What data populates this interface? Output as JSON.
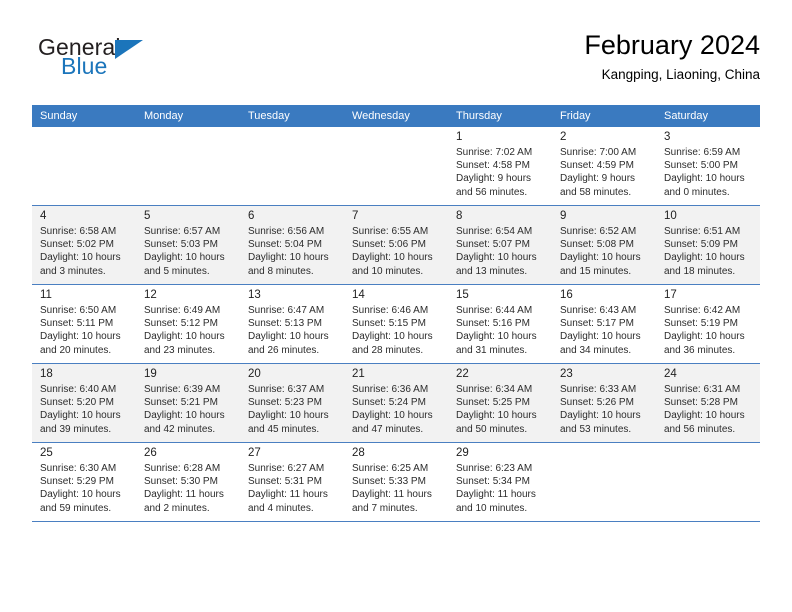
{
  "brand": {
    "name_part1": "General",
    "name_part2": "Blue",
    "triangle_color": "#1b75bb"
  },
  "header": {
    "title": "February 2024",
    "subtitle": "Kangping, Liaoning, China"
  },
  "theme": {
    "header_row_bg": "#3a7ac0",
    "header_row_text": "#ffffff",
    "row_shade_bg": "#f2f2f2",
    "row_border": "#4a7fc1"
  },
  "weekdays": [
    "Sunday",
    "Monday",
    "Tuesday",
    "Wednesday",
    "Thursday",
    "Friday",
    "Saturday"
  ],
  "weeks": [
    [
      {
        "day": "",
        "sunrise": "",
        "sunset": "",
        "daylight1": "",
        "daylight2": ""
      },
      {
        "day": "",
        "sunrise": "",
        "sunset": "",
        "daylight1": "",
        "daylight2": ""
      },
      {
        "day": "",
        "sunrise": "",
        "sunset": "",
        "daylight1": "",
        "daylight2": ""
      },
      {
        "day": "",
        "sunrise": "",
        "sunset": "",
        "daylight1": "",
        "daylight2": ""
      },
      {
        "day": "1",
        "sunrise": "Sunrise: 7:02 AM",
        "sunset": "Sunset: 4:58 PM",
        "daylight1": "Daylight: 9 hours",
        "daylight2": "and 56 minutes."
      },
      {
        "day": "2",
        "sunrise": "Sunrise: 7:00 AM",
        "sunset": "Sunset: 4:59 PM",
        "daylight1": "Daylight: 9 hours",
        "daylight2": "and 58 minutes."
      },
      {
        "day": "3",
        "sunrise": "Sunrise: 6:59 AM",
        "sunset": "Sunset: 5:00 PM",
        "daylight1": "Daylight: 10 hours",
        "daylight2": "and 0 minutes."
      }
    ],
    [
      {
        "day": "4",
        "sunrise": "Sunrise: 6:58 AM",
        "sunset": "Sunset: 5:02 PM",
        "daylight1": "Daylight: 10 hours",
        "daylight2": "and 3 minutes."
      },
      {
        "day": "5",
        "sunrise": "Sunrise: 6:57 AM",
        "sunset": "Sunset: 5:03 PM",
        "daylight1": "Daylight: 10 hours",
        "daylight2": "and 5 minutes."
      },
      {
        "day": "6",
        "sunrise": "Sunrise: 6:56 AM",
        "sunset": "Sunset: 5:04 PM",
        "daylight1": "Daylight: 10 hours",
        "daylight2": "and 8 minutes."
      },
      {
        "day": "7",
        "sunrise": "Sunrise: 6:55 AM",
        "sunset": "Sunset: 5:06 PM",
        "daylight1": "Daylight: 10 hours",
        "daylight2": "and 10 minutes."
      },
      {
        "day": "8",
        "sunrise": "Sunrise: 6:54 AM",
        "sunset": "Sunset: 5:07 PM",
        "daylight1": "Daylight: 10 hours",
        "daylight2": "and 13 minutes."
      },
      {
        "day": "9",
        "sunrise": "Sunrise: 6:52 AM",
        "sunset": "Sunset: 5:08 PM",
        "daylight1": "Daylight: 10 hours",
        "daylight2": "and 15 minutes."
      },
      {
        "day": "10",
        "sunrise": "Sunrise: 6:51 AM",
        "sunset": "Sunset: 5:09 PM",
        "daylight1": "Daylight: 10 hours",
        "daylight2": "and 18 minutes."
      }
    ],
    [
      {
        "day": "11",
        "sunrise": "Sunrise: 6:50 AM",
        "sunset": "Sunset: 5:11 PM",
        "daylight1": "Daylight: 10 hours",
        "daylight2": "and 20 minutes."
      },
      {
        "day": "12",
        "sunrise": "Sunrise: 6:49 AM",
        "sunset": "Sunset: 5:12 PM",
        "daylight1": "Daylight: 10 hours",
        "daylight2": "and 23 minutes."
      },
      {
        "day": "13",
        "sunrise": "Sunrise: 6:47 AM",
        "sunset": "Sunset: 5:13 PM",
        "daylight1": "Daylight: 10 hours",
        "daylight2": "and 26 minutes."
      },
      {
        "day": "14",
        "sunrise": "Sunrise: 6:46 AM",
        "sunset": "Sunset: 5:15 PM",
        "daylight1": "Daylight: 10 hours",
        "daylight2": "and 28 minutes."
      },
      {
        "day": "15",
        "sunrise": "Sunrise: 6:44 AM",
        "sunset": "Sunset: 5:16 PM",
        "daylight1": "Daylight: 10 hours",
        "daylight2": "and 31 minutes."
      },
      {
        "day": "16",
        "sunrise": "Sunrise: 6:43 AM",
        "sunset": "Sunset: 5:17 PM",
        "daylight1": "Daylight: 10 hours",
        "daylight2": "and 34 minutes."
      },
      {
        "day": "17",
        "sunrise": "Sunrise: 6:42 AM",
        "sunset": "Sunset: 5:19 PM",
        "daylight1": "Daylight: 10 hours",
        "daylight2": "and 36 minutes."
      }
    ],
    [
      {
        "day": "18",
        "sunrise": "Sunrise: 6:40 AM",
        "sunset": "Sunset: 5:20 PM",
        "daylight1": "Daylight: 10 hours",
        "daylight2": "and 39 minutes."
      },
      {
        "day": "19",
        "sunrise": "Sunrise: 6:39 AM",
        "sunset": "Sunset: 5:21 PM",
        "daylight1": "Daylight: 10 hours",
        "daylight2": "and 42 minutes."
      },
      {
        "day": "20",
        "sunrise": "Sunrise: 6:37 AM",
        "sunset": "Sunset: 5:23 PM",
        "daylight1": "Daylight: 10 hours",
        "daylight2": "and 45 minutes."
      },
      {
        "day": "21",
        "sunrise": "Sunrise: 6:36 AM",
        "sunset": "Sunset: 5:24 PM",
        "daylight1": "Daylight: 10 hours",
        "daylight2": "and 47 minutes."
      },
      {
        "day": "22",
        "sunrise": "Sunrise: 6:34 AM",
        "sunset": "Sunset: 5:25 PM",
        "daylight1": "Daylight: 10 hours",
        "daylight2": "and 50 minutes."
      },
      {
        "day": "23",
        "sunrise": "Sunrise: 6:33 AM",
        "sunset": "Sunset: 5:26 PM",
        "daylight1": "Daylight: 10 hours",
        "daylight2": "and 53 minutes."
      },
      {
        "day": "24",
        "sunrise": "Sunrise: 6:31 AM",
        "sunset": "Sunset: 5:28 PM",
        "daylight1": "Daylight: 10 hours",
        "daylight2": "and 56 minutes."
      }
    ],
    [
      {
        "day": "25",
        "sunrise": "Sunrise: 6:30 AM",
        "sunset": "Sunset: 5:29 PM",
        "daylight1": "Daylight: 10 hours",
        "daylight2": "and 59 minutes."
      },
      {
        "day": "26",
        "sunrise": "Sunrise: 6:28 AM",
        "sunset": "Sunset: 5:30 PM",
        "daylight1": "Daylight: 11 hours",
        "daylight2": "and 2 minutes."
      },
      {
        "day": "27",
        "sunrise": "Sunrise: 6:27 AM",
        "sunset": "Sunset: 5:31 PM",
        "daylight1": "Daylight: 11 hours",
        "daylight2": "and 4 minutes."
      },
      {
        "day": "28",
        "sunrise": "Sunrise: 6:25 AM",
        "sunset": "Sunset: 5:33 PM",
        "daylight1": "Daylight: 11 hours",
        "daylight2": "and 7 minutes."
      },
      {
        "day": "29",
        "sunrise": "Sunrise: 6:23 AM",
        "sunset": "Sunset: 5:34 PM",
        "daylight1": "Daylight: 11 hours",
        "daylight2": "and 10 minutes."
      },
      {
        "day": "",
        "sunrise": "",
        "sunset": "",
        "daylight1": "",
        "daylight2": ""
      },
      {
        "day": "",
        "sunrise": "",
        "sunset": "",
        "daylight1": "",
        "daylight2": ""
      }
    ]
  ]
}
